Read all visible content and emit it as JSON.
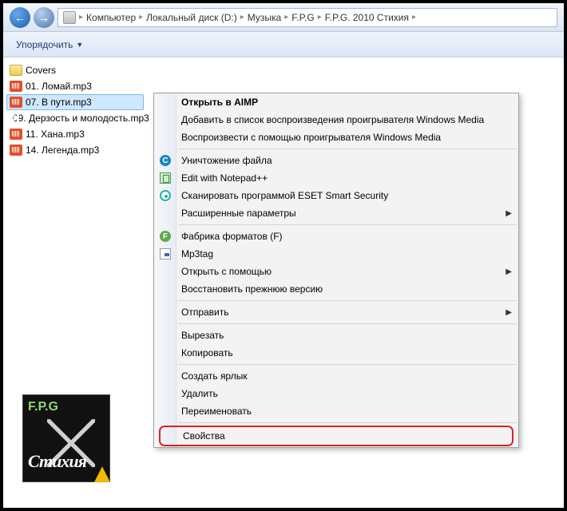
{
  "breadcrumbs": [
    "Компьютер",
    "Локальный диск (D:)",
    "Музыка",
    "F.P.G",
    "F.P.G. 2010 Стихия"
  ],
  "toolbar": {
    "organize": "Упорядочить"
  },
  "files": [
    {
      "name": "Covers",
      "type": "folder"
    },
    {
      "name": "01. Ломай.mp3",
      "type": "audio"
    },
    {
      "name": "07. В пути.mp3",
      "type": "audio",
      "selected": true
    },
    {
      "name": "09. Дерзость и молодость.mp3",
      "type": "audio"
    },
    {
      "name": "11. Хана.mp3",
      "type": "audio"
    },
    {
      "name": "14. Легенда.mp3",
      "type": "audio"
    }
  ],
  "context_menu": [
    {
      "label": "Открыть в AIMP",
      "bold": true
    },
    {
      "label": "Добавить в список воспроизведения проигрывателя Windows Media"
    },
    {
      "label": "Воспроизвести с помощью проигрывателя Windows Media"
    },
    {
      "sep": true
    },
    {
      "label": "Уничтожение файла",
      "icon": "circle-c"
    },
    {
      "label": "Edit with Notepad++",
      "icon": "npp"
    },
    {
      "label": "Сканировать программой ESET Smart Security",
      "icon": "eset"
    },
    {
      "label": "Расширенные параметры",
      "submenu": true
    },
    {
      "sep": true
    },
    {
      "label": "Фабрика форматов (F)",
      "icon": "ff"
    },
    {
      "label": "Mp3tag",
      "icon": "mp3"
    },
    {
      "label": "Открыть с помощью",
      "submenu": true
    },
    {
      "label": "Восстановить прежнюю версию"
    },
    {
      "sep": true
    },
    {
      "label": "Отправить",
      "submenu": true
    },
    {
      "sep": true
    },
    {
      "label": "Вырезать"
    },
    {
      "label": "Копировать"
    },
    {
      "sep": true
    },
    {
      "label": "Создать ярлык"
    },
    {
      "label": "Удалить"
    },
    {
      "label": "Переименовать"
    },
    {
      "sep": true
    },
    {
      "label": "Свойства",
      "highlighted": true
    }
  ],
  "preview": {
    "artist": "F.P.G",
    "album": "Стихия"
  }
}
